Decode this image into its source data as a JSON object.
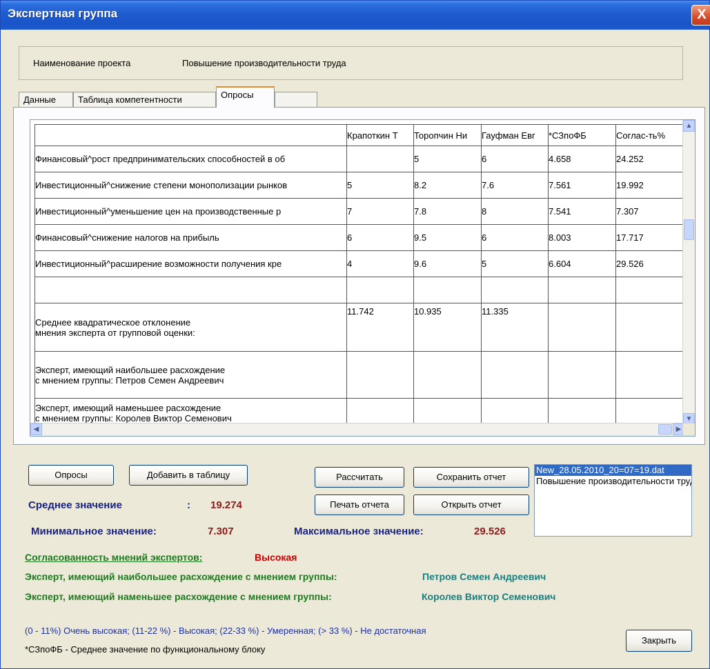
{
  "window": {
    "title": "Экспертная группа",
    "close_label": "X"
  },
  "project": {
    "label": "Наименование проекта",
    "value": "Повышение производительности труда"
  },
  "tabs": [
    {
      "label": "Данные"
    },
    {
      "label": "Таблица компетентности"
    },
    {
      "label": "Опросы"
    },
    {
      "label": ""
    }
  ],
  "table": {
    "columns": [
      "",
      "Крапоткин Т",
      "Торопчин Ни",
      "Гауфман Евг",
      "*СЗпоФБ",
      "Соглас-ть%"
    ],
    "rows": [
      [
        "Финансовый^рост предпринимательских способностей в об",
        "",
        "5",
        "6",
        "4.658",
        "24.252"
      ],
      [
        "Инвестиционный^снижение степени монополизации рынков",
        "5",
        "8.2",
        "7.6",
        "7.561",
        "19.992"
      ],
      [
        "Инвестиционный^уменьшение цен на производственные р",
        "7",
        "7.8",
        "8",
        "7.541",
        "7.307"
      ],
      [
        "Финансовый^снижение налогов на прибыль",
        "6",
        "9.5",
        "6",
        "8.003",
        "17.717"
      ],
      [
        "Инвестиционный^расширение возможности получения кре",
        "4",
        "9.6",
        "5",
        "6.604",
        "29.526"
      ],
      [
        "",
        "",
        "",
        "",
        "",
        ""
      ]
    ],
    "sko_line1": "Среднее квадратическое отклонение",
    "sko_line2": "мнения эксперта от групповой оценки:",
    "sko_values": [
      "11.742",
      "10.935",
      "11.335"
    ],
    "max_line1": "Эксперт, имеющий наибольшее расхождение",
    "max_line2": "с мнением группы: Петров Семен Андреевич",
    "min_line1": "Эксперт, имеющий наменьшее расхождение",
    "min_line2": "с мнением группы: Королев Виктор Семенович"
  },
  "buttons": {
    "polls": "Опросы",
    "add_to_table": "Добавить в таблицу",
    "calculate": "Рассчитать",
    "save_report": "Сохранить отчет",
    "print_report": "Печать отчета",
    "open_report": "Открыть отчет",
    "close": "Закрыть"
  },
  "stats": {
    "avg_label": "Среднее значение",
    "avg_colon": ":",
    "avg_value": "19.274",
    "min_label": "Минимальное значение:",
    "min_value": "7.307",
    "max_label": "Максимальное значение:",
    "max_value": "29.526"
  },
  "listbox": {
    "items": [
      "New_28.05.2010_20=07=19.dat",
      "Повышение производительности труда"
    ],
    "selected_index": 0
  },
  "summary": {
    "consistency_label": "Согласованность мнений экспертов:",
    "consistency_value": "Высокая",
    "max_expert_label": "Эксперт, имеющий наибольшее расхождение с мнением группы:",
    "max_expert_value": "Петров Семен Андреевич",
    "min_expert_label": "Эксперт, имеющий наменьшее расхождение с мнением группы:",
    "min_expert_value": "Королев Виктор Семенович"
  },
  "legend": {
    "scale": "(0 - 11%) Очень высокая; (11-22 %) - Высокая; (22-33 %) - Умеренная; (> 33 %) - Не достаточная",
    "note": "*СЗпоФБ - Среднее значение по функциональному блоку"
  },
  "colors": {
    "title_bar": "#1f5ccf",
    "stat_label": "#1a237e",
    "stat_value": "#8b1a1a",
    "green_label": "#1e7a1e",
    "red_value": "#cc0000",
    "teal_value": "#178080",
    "legend_blue": "#1c2fa8",
    "selection": "#316ac5"
  },
  "icons": {
    "close": "close-x-icon",
    "scroll_up": "triangle-up-icon",
    "scroll_down": "triangle-down-icon",
    "scroll_left": "triangle-left-icon",
    "scroll_right": "triangle-right-icon"
  }
}
